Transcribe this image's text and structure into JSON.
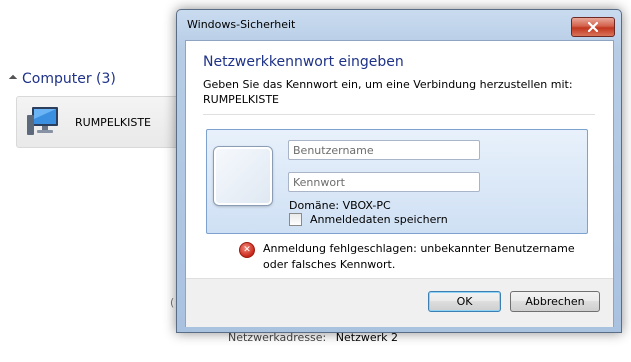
{
  "background": {
    "group_header": "Computer (3)",
    "computer_name": "RUMPELKISTE",
    "network_address_label": "Netzwerkadresse:",
    "network_address_value": "Netzwerk  2"
  },
  "dialog": {
    "title": "Windows-Sicherheit",
    "heading": "Netzwerkkennwort eingeben",
    "subtext_line1": "Geben Sie das Kennwort ein, um eine Verbindung herzustellen mit:",
    "subtext_line2": "RUMPELKISTE",
    "username_placeholder": "Benutzername",
    "password_placeholder": "Kennwort",
    "domain_text": "Domäne: VBOX-PC",
    "remember_label": "Anmeldedaten speichern",
    "error_line1": "Anmeldung fehlgeschlagen: unbekannter Benutzername",
    "error_line2": "oder falsches Kennwort.",
    "ok_label": "OK",
    "cancel_label": "Abbrechen"
  },
  "colors": {
    "heading": "#1e3287",
    "close_button": "#c2361f",
    "error_icon": "#c8281b"
  },
  "icons": {
    "close": "close-icon",
    "error": "error-icon",
    "computer": "computer-icon",
    "user_tile": "user-avatar"
  }
}
